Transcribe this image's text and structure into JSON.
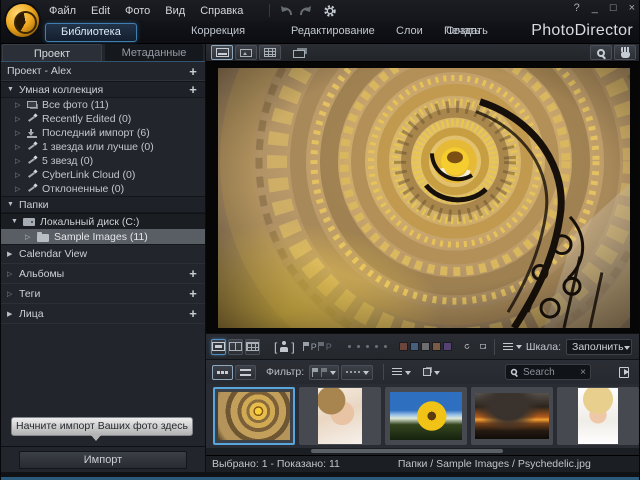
{
  "window": {
    "help": "?",
    "minimize": "_",
    "maximize": "□",
    "close": "×"
  },
  "menubar": {
    "items": [
      "Файл",
      "Edit",
      "Фото",
      "Вид",
      "Справка"
    ]
  },
  "tabs": {
    "library": "Библиотека",
    "adjustment": "Коррекция",
    "edit": "Редактирование",
    "layers": "Слои",
    "create": "Создать",
    "print": "Печать",
    "brand": "PhotoDirector"
  },
  "sidebar": {
    "tab_project": "Проект",
    "tab_metadata": "Метаданные",
    "project_title": "Проект - Alex",
    "plus": "+",
    "smart_header": "Умная коллекция",
    "items": [
      "Все фото (11)",
      "Recently Edited (0)",
      "Последний импорт (6)",
      "1 звезда или лучше (0)",
      "5 звезд (0)",
      "CyberLink Cloud (0)",
      "Отклоненные (0)"
    ],
    "folders_header": "Папки",
    "folder_drive": "Локальный диск (C:)",
    "folder_selected": "Sample Images (11)",
    "calendar": "Calendar View",
    "albums": "Альбомы",
    "tags": "Теги",
    "faces": "Лица",
    "import_hint": "Начните импорт Ваших фото здесь",
    "import_button": "Импорт"
  },
  "icons": {
    "expand_open": "▼",
    "collapse": "▷",
    "collapse_filled": "▶",
    "pick_label": "P"
  },
  "adjust_toolbar": {
    "scale_label": "Шкала:",
    "scale_value": "Заполнить",
    "swatches": [
      "#6b463c",
      "#44607e",
      "#6e6e70",
      "#7c5a44",
      "#564272"
    ]
  },
  "filmstrip": {
    "filter_label": "Фильтр:",
    "search_placeholder": "Search",
    "clear": "×",
    "thumbnails": [
      "spiral-staircase",
      "portrait-woman",
      "sunflower",
      "sunset-storm",
      "portrait-blonde"
    ]
  },
  "statusbar": {
    "selection": "Выбрано: 1 - Показано: 11",
    "path": "Папки / Sample Images / Psychedelic.jpg"
  },
  "colors": {
    "accent": "#4f9fd8",
    "selection": "#58a6dd"
  }
}
